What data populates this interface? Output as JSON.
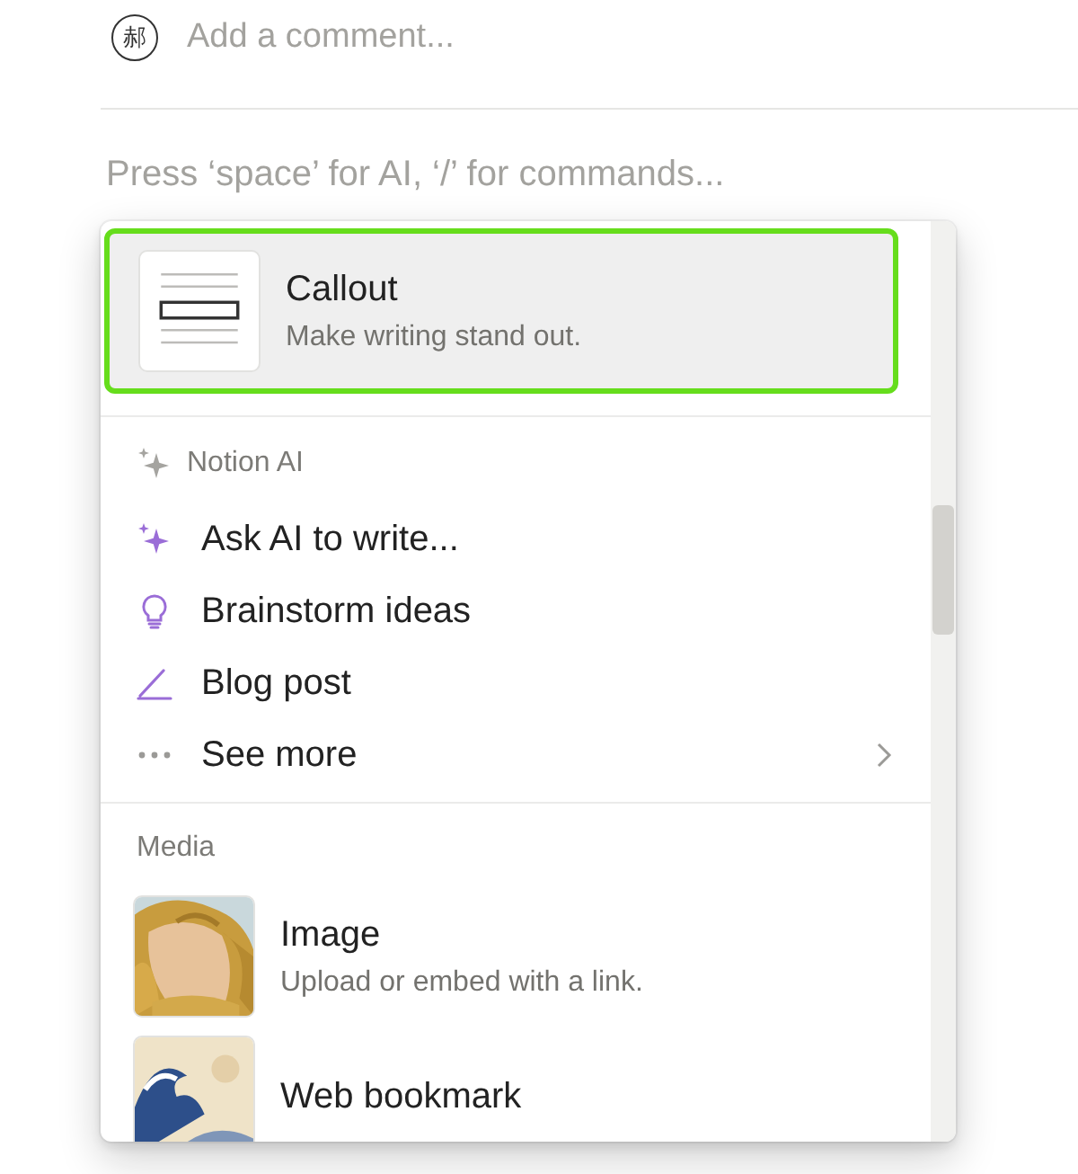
{
  "comment": {
    "avatar": "郝",
    "placeholder": "Add a comment..."
  },
  "editor": {
    "placeholder": "Press ‘space’ for AI, ‘/’ for commands..."
  },
  "menu": {
    "top": [
      {
        "kind": "callout",
        "title": "Callout",
        "description": "Make writing stand out.",
        "selected": true
      }
    ],
    "sections": [
      {
        "title": "Notion AI",
        "items": [
          {
            "kind": "sparkle",
            "label": "Ask AI to write...",
            "selected": false
          },
          {
            "kind": "bulb",
            "label": "Brainstorm ideas",
            "selected": false
          },
          {
            "kind": "pen",
            "label": "Blog post",
            "selected": false
          },
          {
            "kind": "dots",
            "label": "See more",
            "selected": false
          }
        ]
      },
      {
        "title": "Media",
        "blocks": [
          {
            "title": "Image",
            "description": "Upload or embed with a link.",
            "selected": false
          },
          {
            "kind": "bookmark",
            "title": "Web bookmark",
            "selected": false
          }
        ]
      }
    ]
  }
}
